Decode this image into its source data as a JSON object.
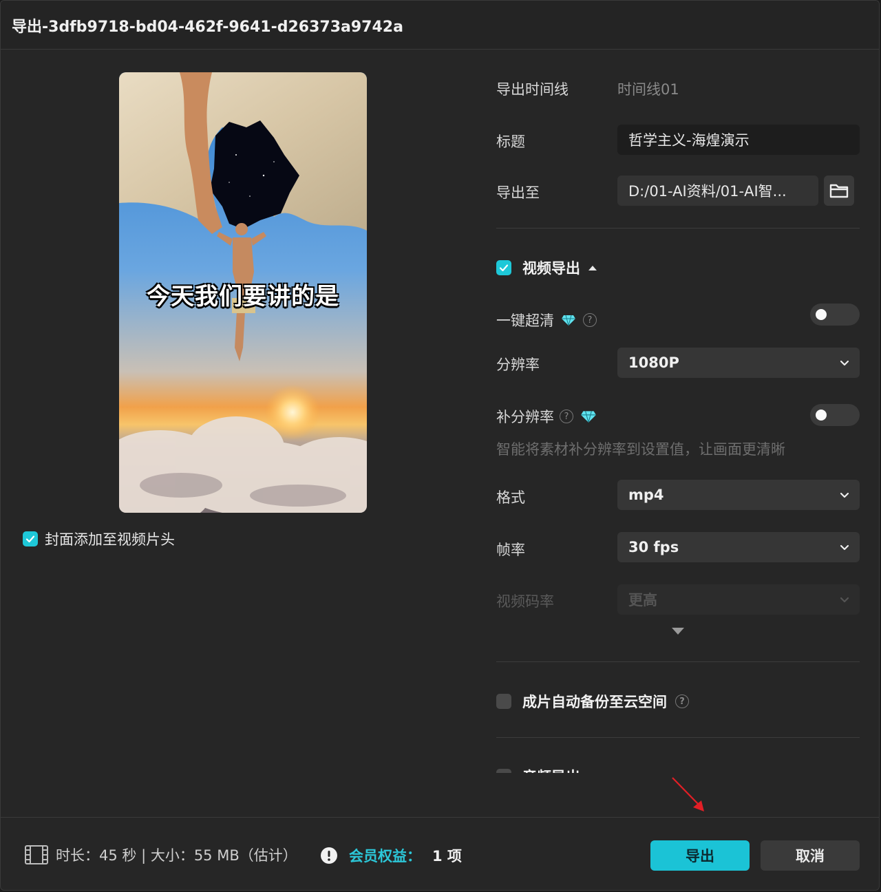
{
  "window": {
    "title": "导出-3dfb9718-bd04-462f-9641-d26373a9742a"
  },
  "preview": {
    "caption": "今天我们要讲的是"
  },
  "cover": {
    "checked": true,
    "label": "封面添加至视频片头"
  },
  "export_timeline": {
    "label": "导出时间线",
    "value": "时间线01"
  },
  "title_field": {
    "label": "标题",
    "value": "哲学主义-海煌演示"
  },
  "export_to": {
    "label": "导出至",
    "value": "D:/01-AI资料/01-AI智..."
  },
  "video_export": {
    "title": "视频导出",
    "checked": true,
    "one_key_hd": {
      "label": "一键超清",
      "on": false
    },
    "resolution": {
      "label": "分辨率",
      "value": "1080P"
    },
    "super_resolution": {
      "label": "补分辨率",
      "on": false,
      "hint": "智能将素材补分辨率到设置值，让画面更清晰"
    },
    "format": {
      "label": "格式",
      "value": "mp4"
    },
    "frame_rate": {
      "label": "帧率",
      "value": "30 fps"
    },
    "bitrate": {
      "label": "视频码率",
      "value": "更高"
    }
  },
  "cloud_backup": {
    "label": "成片自动备份至云空间",
    "checked": false
  },
  "audio_export": {
    "label": "音频导出"
  },
  "footer": {
    "info": "时长：45 秒 | 大小：55 MB（估计）",
    "member_label": "会员权益：",
    "member_count": "1 项",
    "export_button": "导出",
    "cancel_button": "取消"
  },
  "colors": {
    "accent": "#1bc3d6",
    "panel": "#262626",
    "field": "#363636"
  }
}
